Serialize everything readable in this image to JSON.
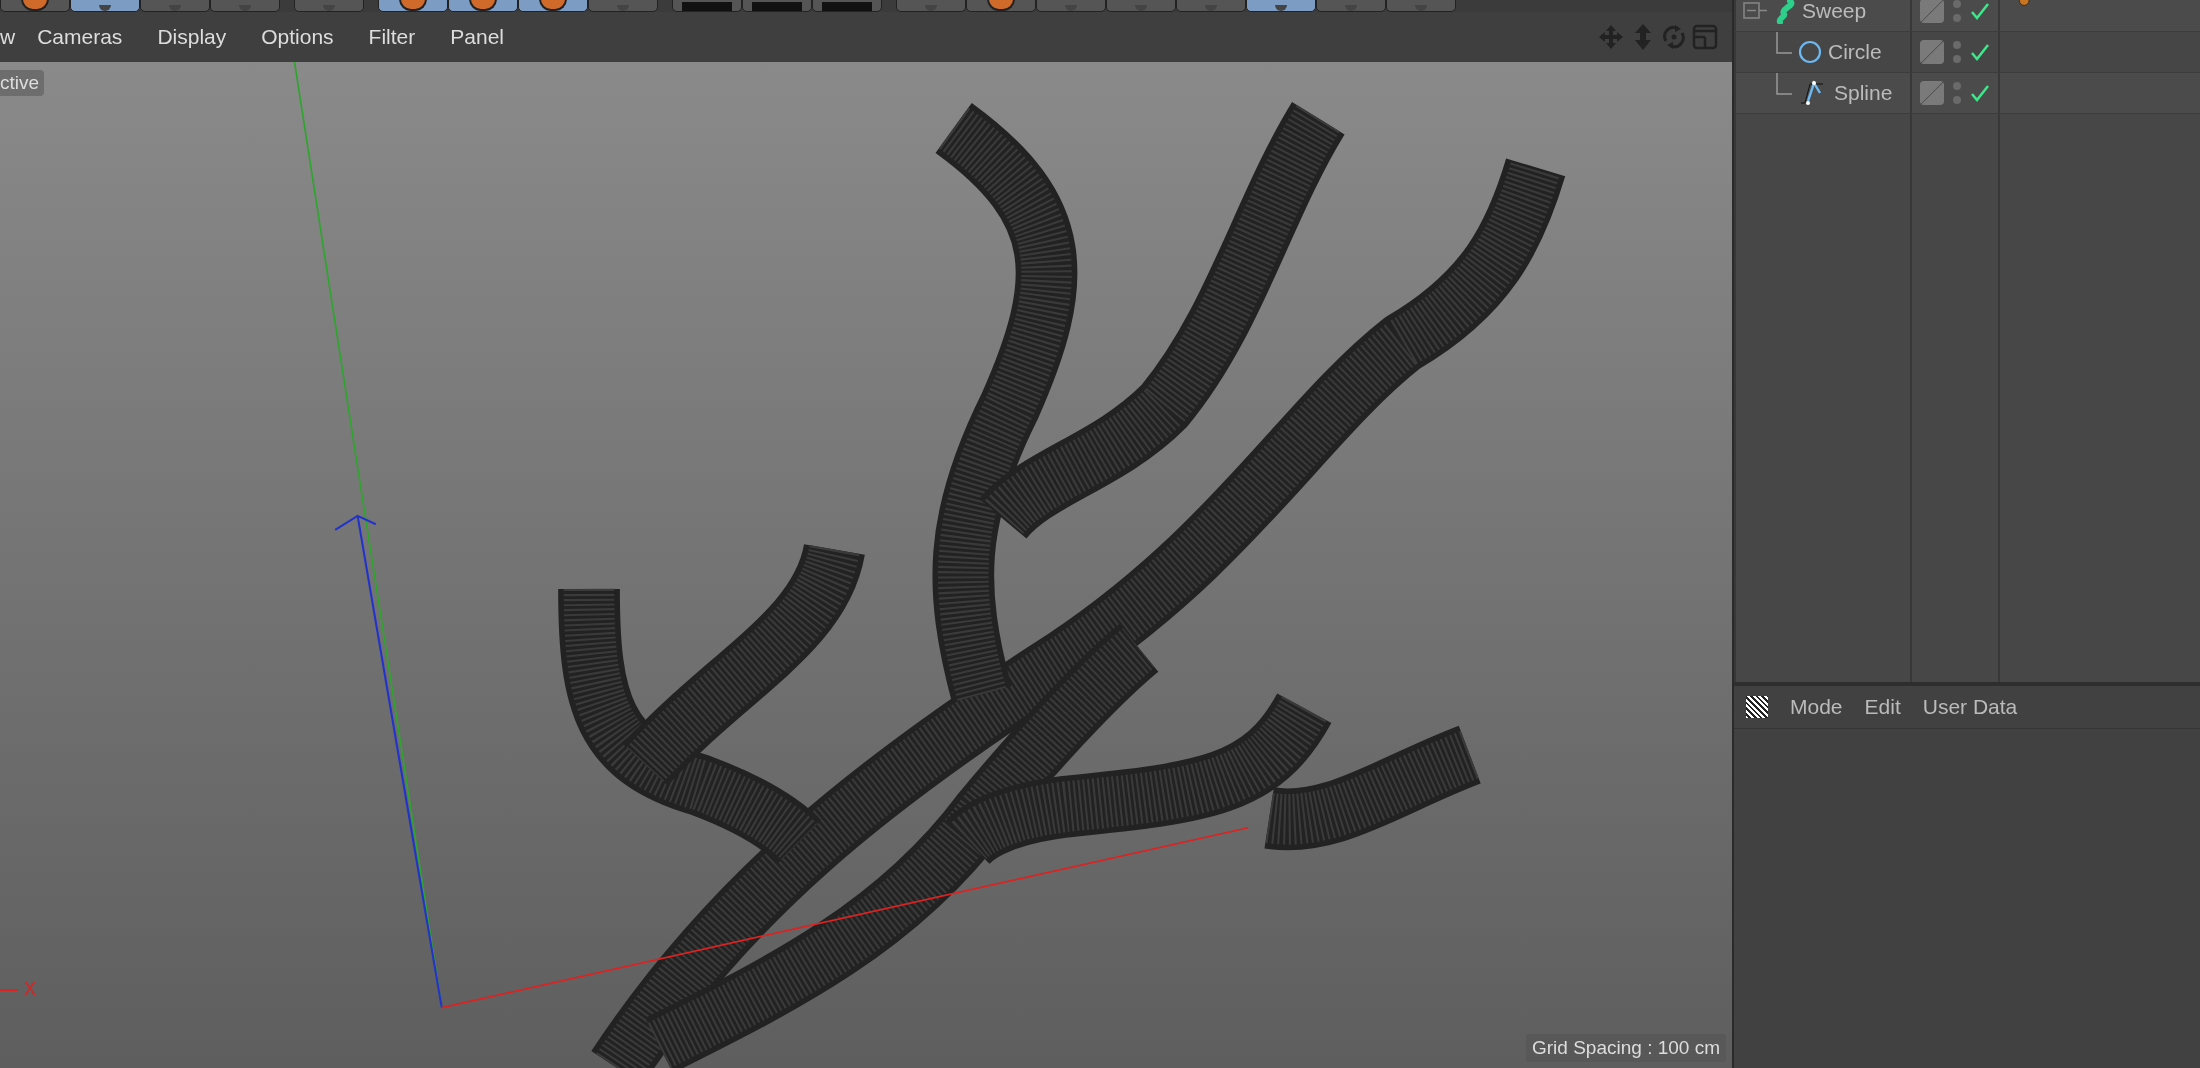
{
  "toolbar": {
    "groups": [
      {
        "buttons": [
          {
            "kind": "orange",
            "selected": false
          },
          {
            "kind": "plain",
            "selected": true
          },
          {
            "kind": "plain",
            "selected": false
          },
          {
            "kind": "plain",
            "selected": false
          }
        ]
      },
      {
        "buttons": [
          {
            "kind": "plain",
            "selected": false
          }
        ]
      },
      {
        "buttons": [
          {
            "kind": "orange",
            "selected": true
          },
          {
            "kind": "orange",
            "selected": true
          },
          {
            "kind": "orange",
            "selected": true
          },
          {
            "kind": "plain",
            "selected": false
          }
        ]
      },
      {
        "buttons": [
          {
            "kind": "dark",
            "selected": false
          },
          {
            "kind": "dark",
            "selected": false
          },
          {
            "kind": "dark",
            "selected": false
          }
        ]
      },
      {
        "buttons": [
          {
            "kind": "plain",
            "selected": false
          },
          {
            "kind": "orange",
            "selected": false
          },
          {
            "kind": "plain",
            "selected": false
          },
          {
            "kind": "plain",
            "selected": false
          },
          {
            "kind": "plain",
            "selected": false
          },
          {
            "kind": "plain",
            "selected": true
          },
          {
            "kind": "plain",
            "selected": false
          },
          {
            "kind": "plain",
            "selected": false
          }
        ]
      }
    ]
  },
  "viewport": {
    "menu": [
      "w",
      "Cameras",
      "Display",
      "Options",
      "Filter",
      "Panel"
    ],
    "view_label": "ctive",
    "axis_label": "X",
    "grid_spacing": "Grid Spacing : 100 cm"
  },
  "objects": [
    {
      "name": "Sweep",
      "kind": "sweep",
      "expanded": true,
      "enabled": true,
      "tag": true,
      "children": [
        {
          "name": "Circle",
          "kind": "circle",
          "enabled": true,
          "tag": false
        },
        {
          "name": "Spline",
          "kind": "spline",
          "enabled": true,
          "tag": false
        }
      ]
    }
  ],
  "attributes": {
    "menu": [
      "Mode",
      "Edit",
      "User Data"
    ]
  }
}
